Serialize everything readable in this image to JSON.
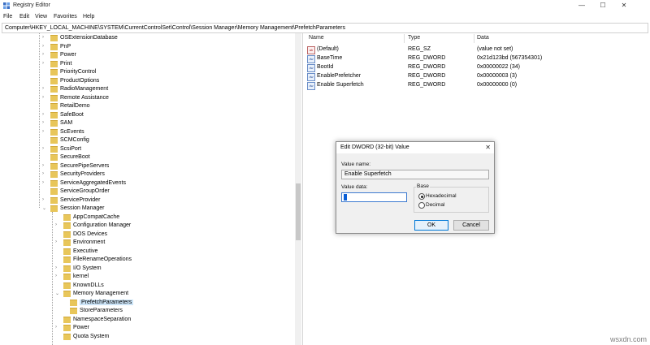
{
  "window": {
    "title": "Registry Editor",
    "minimize": "—",
    "maximize": "☐",
    "close": "✕"
  },
  "menu": [
    "File",
    "Edit",
    "View",
    "Favorites",
    "Help"
  ],
  "address": "Computer\\HKEY_LOCAL_MACHINE\\SYSTEM\\CurrentControlSet\\Control\\Session Manager\\Memory Management\\PrefetchParameters",
  "tree": {
    "level1": [
      "OSExtensionDatabase",
      "PnP",
      "Power",
      "Print",
      "PriorityControl",
      "ProductOptions",
      "RadioManagement",
      "Remote Assistance",
      "RetailDemo",
      "SafeBoot",
      "SAM",
      "ScEvents",
      "SCMConfig",
      "ScsiPort",
      "SecureBoot",
      "SecurePipeServers",
      "SecurityProviders",
      "ServiceAggregatedEvents",
      "ServiceGroupOrder",
      "ServiceProvider",
      "Session Manager"
    ],
    "level2a": [
      "AppCompatCache",
      "Configuration Manager",
      "DOS Devices",
      "Environment",
      "Executive",
      "FileRenameOperations",
      "I/O System",
      "kernel",
      "KnownDLLs",
      "Memory Management"
    ],
    "level3": [
      "PrefetchParameters",
      "StoreParameters"
    ],
    "level2b": [
      "NamespaceSeparation",
      "Power",
      "Quota System"
    ],
    "selected": "PrefetchParameters"
  },
  "list": {
    "headers": {
      "name": "Name",
      "type": "Type",
      "data": "Data"
    },
    "rows": [
      {
        "name": "(Default)",
        "type": "REG_SZ",
        "data": "(value not set)",
        "icon": "ab"
      },
      {
        "name": "BaseTime",
        "type": "REG_DWORD",
        "data": "0x21d123bd (567354301)",
        "icon": "dw"
      },
      {
        "name": "BootId",
        "type": "REG_DWORD",
        "data": "0x00000022 (34)",
        "icon": "dw"
      },
      {
        "name": "EnablePrefetcher",
        "type": "REG_DWORD",
        "data": "0x00000003 (3)",
        "icon": "dw"
      },
      {
        "name": "Enable Superfetch",
        "type": "REG_DWORD",
        "data": "0x00000000 (0)",
        "icon": "dw"
      }
    ]
  },
  "dialog": {
    "title": "Edit DWORD (32-bit) Value",
    "close": "✕",
    "value_name_label": "Value name:",
    "value_name": "Enable Superfetch",
    "value_data_label": "Value data:",
    "value_data": "",
    "base_label": "Base",
    "hex_label": "Hexadecimal",
    "dec_label": "Decimal",
    "ok": "OK",
    "cancel": "Cancel"
  },
  "watermark": "wsxdn.com"
}
